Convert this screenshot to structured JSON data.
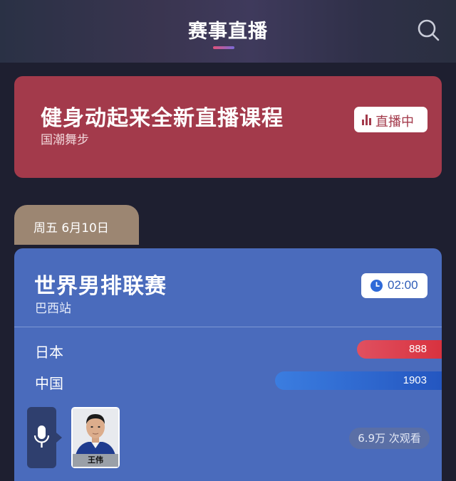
{
  "header": {
    "title": "赛事直播",
    "search_icon": "search-icon"
  },
  "live_card": {
    "title": "健身动起来全新直播课程",
    "subtitle": "国潮舞步",
    "badge": "直播中"
  },
  "date_tab": {
    "label": "周五 6月10日"
  },
  "match": {
    "title": "世界男排联赛",
    "subtitle": "巴西站",
    "time": "02:00",
    "teams": [
      {
        "name": "日本",
        "score": "888"
      },
      {
        "name": "中国",
        "score": "1903"
      }
    ],
    "host_name": "王伟",
    "views": "6.9万 次观看"
  },
  "colors": {
    "live_card": "#a33a4b",
    "match_card": "#4a6bbc",
    "date_tab": "#9c8672",
    "page_bg": "#1e1f30"
  }
}
